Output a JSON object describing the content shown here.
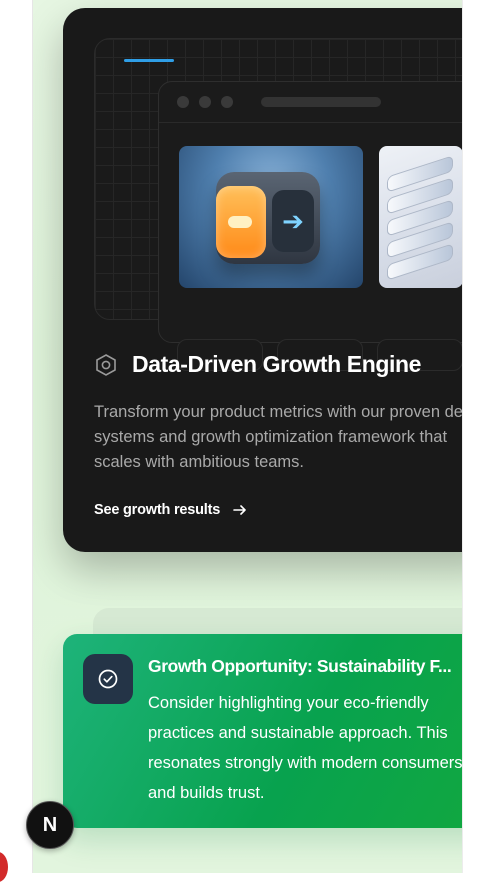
{
  "card": {
    "title": "Data-Driven Growth Engine",
    "description": "Transform your product metrics with our proven design systems and growth optimization framework that scales with ambitious teams.",
    "link_label": "See growth results",
    "title_icon": "hexagon-gear-icon",
    "link_icon": "arrow-right-icon",
    "background": "#191919",
    "accent": "#2f9ee6"
  },
  "notification": {
    "title": "Growth Opportunity: Sustainability F...",
    "body": "Consider highlighting your eco-friendly practices and sustainable approach. This resonates strongly with modern consumers and builds trust.",
    "icon": "check-circle-icon",
    "color": "#08a24e"
  },
  "fab": {
    "label": "N",
    "icon": "nextjs-logo"
  }
}
